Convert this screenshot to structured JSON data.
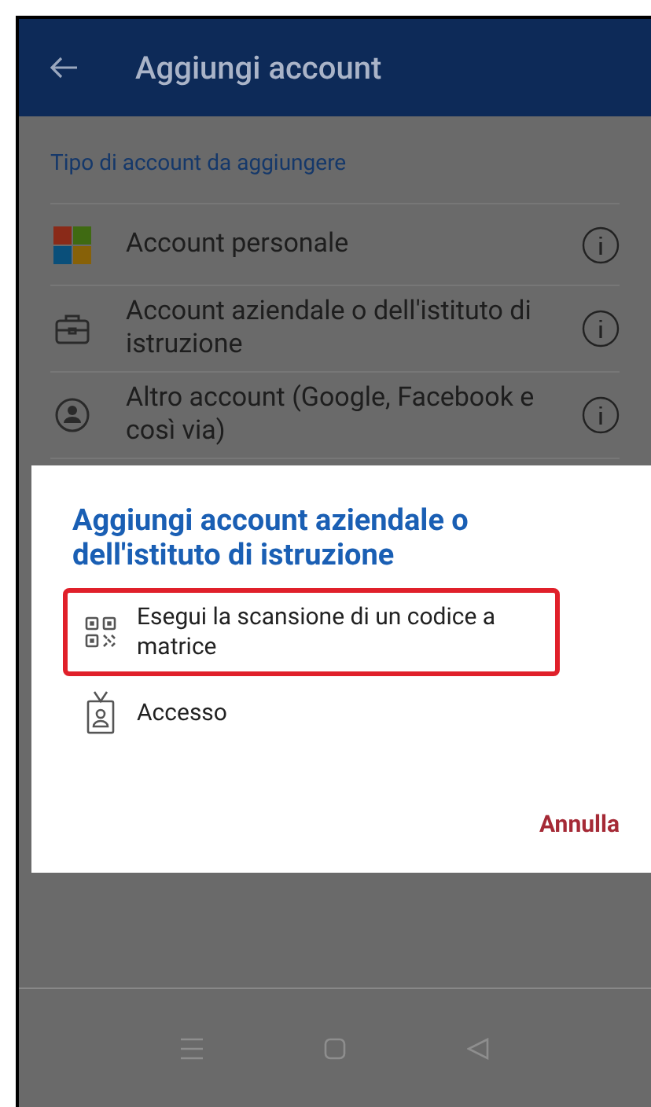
{
  "app_bar": {
    "title": "Aggiungi account"
  },
  "section_label": "Tipo di account da aggiungere",
  "account_types": [
    {
      "kind": "microsoft",
      "label": "Account personale"
    },
    {
      "kind": "briefcase",
      "label": "Account aziendale o dell'istituto di istruzione"
    },
    {
      "kind": "person",
      "label": "Altro account (Google, Facebook e così via)"
    }
  ],
  "dialog": {
    "title": "Aggiungi account aziendale o dell'istituto di istruzione",
    "options": [
      {
        "kind": "qr",
        "label": "Esegui la scansione di un codice a matrice",
        "highlighted": true
      },
      {
        "kind": "badge",
        "label": "Accesso",
        "highlighted": false
      }
    ],
    "cancel": "Annulla"
  }
}
